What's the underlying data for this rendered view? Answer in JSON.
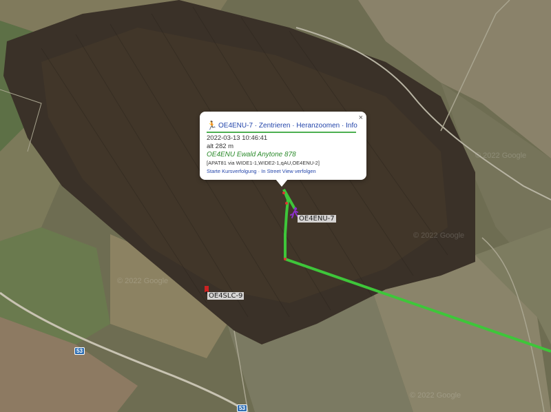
{
  "map": {
    "type": "satellite",
    "imagery_watermark": "© 2022 Google",
    "track_color": "#3ec63a",
    "station_labels": {
      "enu": "OE4ENU-7",
      "slc": "OE4SLC-9"
    },
    "road_shields": [
      "53",
      "53"
    ]
  },
  "popup": {
    "icon": "runner-icon",
    "callsign": "OE4ENU-7",
    "links": {
      "center": "Zentrieren",
      "zoom": "Heranzoomen",
      "info": "Info"
    },
    "close_label": "×",
    "timestamp": "2022-03-13 10:46:41",
    "altitude": "alt 282 m",
    "comment": "OE4ENU Ewald Anytone 878",
    "path": "[APAT81 via WIDE1-1,WIDE2-1,qAU,OE4ENU-2]",
    "track_link": "Starte Kursverfolgung",
    "streetview_link": "In Street View verfolgen"
  }
}
